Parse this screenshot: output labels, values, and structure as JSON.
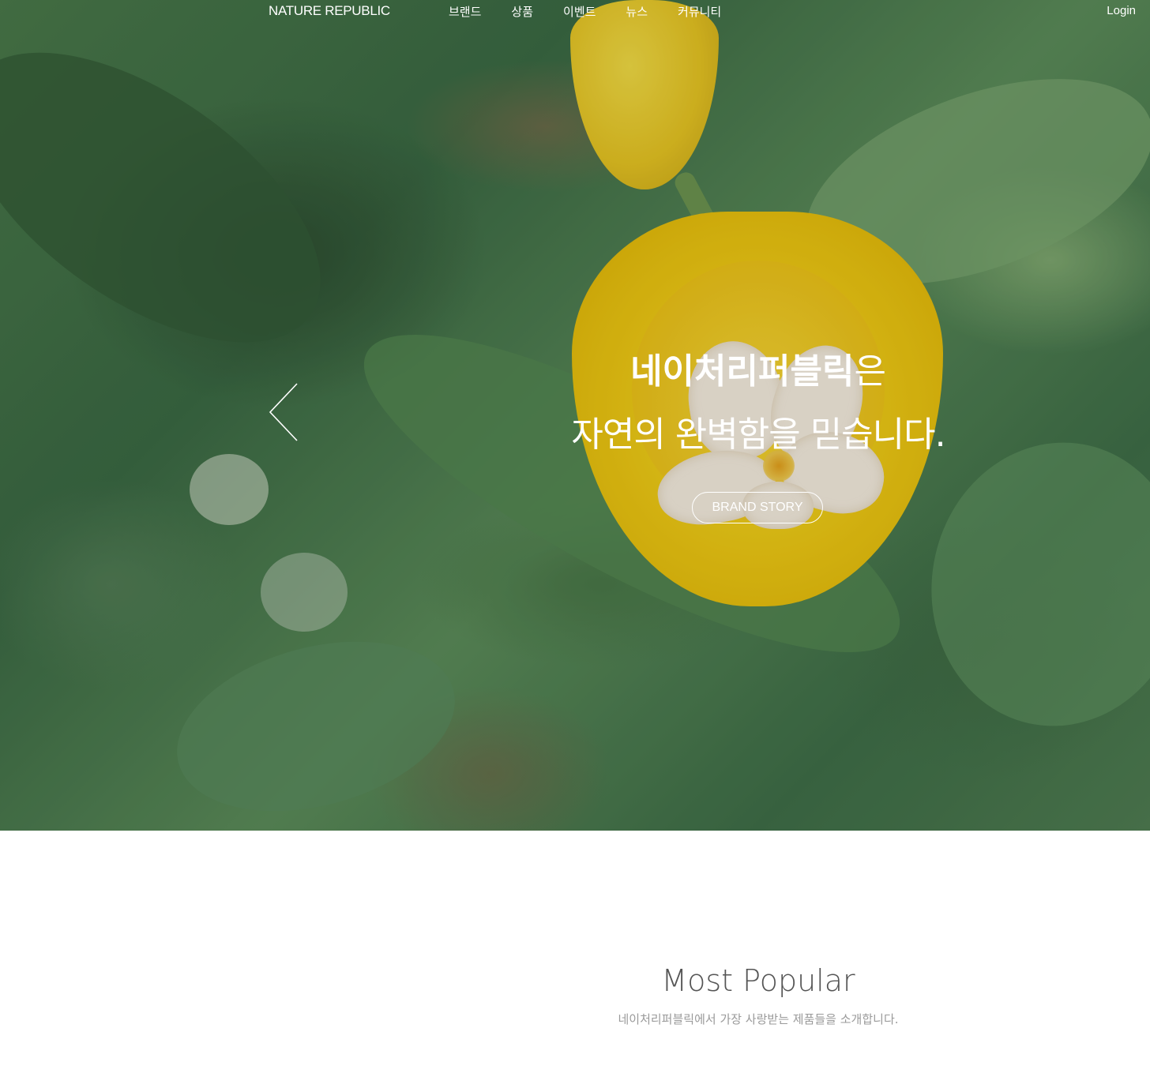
{
  "header": {
    "logo": "NATURE REPUBLIC",
    "nav": [
      "브랜드",
      "상품",
      "이벤트",
      "뉴스",
      "커뮤니티"
    ],
    "login": "Login"
  },
  "hero": {
    "headline_bold": "네이처리퍼블릭",
    "headline_suffix": "은",
    "headline_line2": "자연의 완벽함을 믿습니다.",
    "button": "BRAND STORY",
    "prev_icon": "chevron-left-icon"
  },
  "popular": {
    "title": "Most Popular",
    "subtitle": "네이처리퍼블릭에서 가장 사랑받는 제품들을 소개합니다."
  },
  "colors": {
    "text_on_hero": "#ffffff",
    "tulip": "#f2cf18",
    "section_title": "#555555",
    "section_subtitle": "#9a9a9a"
  }
}
